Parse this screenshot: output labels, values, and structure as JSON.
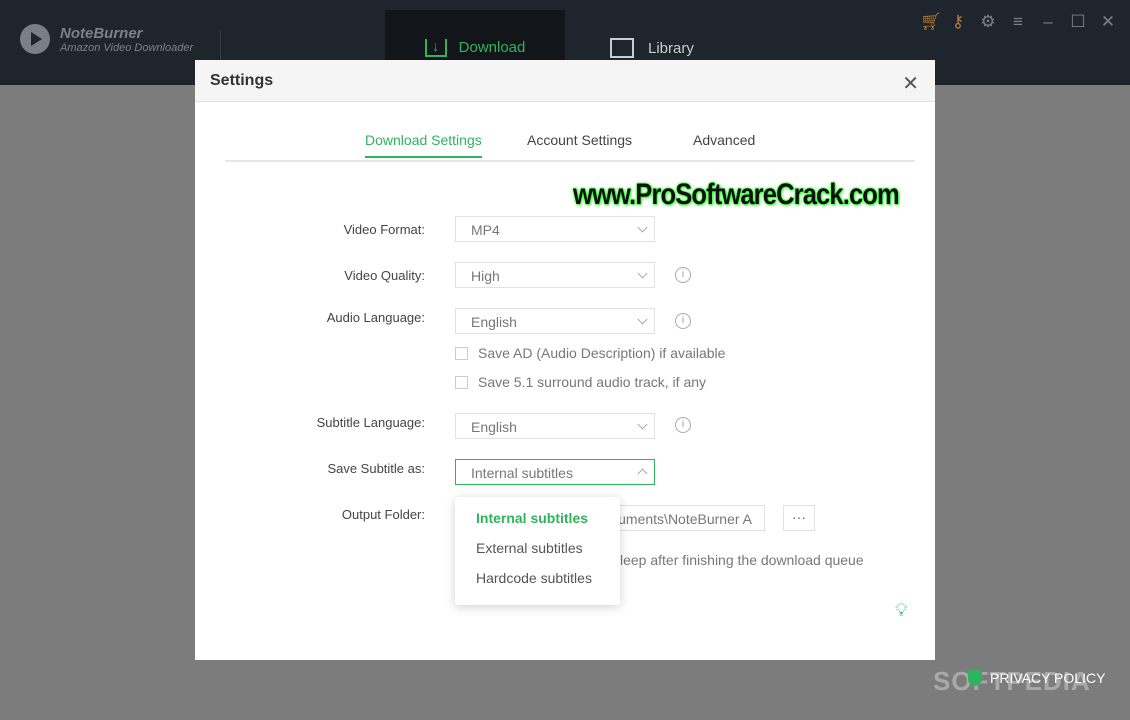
{
  "app": {
    "name": "NoteBurner",
    "subtitle": "Amazon Video Downloader"
  },
  "nav": {
    "download": "Download",
    "library": "Library"
  },
  "title_icons": [
    "cart-icon",
    "key-icon",
    "gear-icon",
    "menu-icon",
    "minimize-icon",
    "maximize-icon",
    "close-icon"
  ],
  "dialog": {
    "title": "Settings",
    "tabs": [
      "Download Settings",
      "Account Settings",
      "Advanced"
    ],
    "fields": {
      "video_format": {
        "label": "Video Format:",
        "value": "MP4"
      },
      "video_quality": {
        "label": "Video Quality:",
        "value": "High"
      },
      "audio_language": {
        "label": "Audio Language:",
        "value": "English"
      },
      "save_ad": "Save AD (Audio Description) if available",
      "save_51": "Save 5.1 surround audio track, if any",
      "subtitle_language": {
        "label": "Subtitle Language:",
        "value": "English"
      },
      "save_subtitle": {
        "label": "Save Subtitle as:",
        "value": "Internal subtitles",
        "options": [
          "Internal subtitles",
          "External subtitles",
          "Hardcode subtitles"
        ]
      },
      "output_folder": {
        "label": "Output Folder:",
        "value": "uments\\NoteBurner A",
        "browse": "···"
      },
      "sleep": "leep after finishing the download queue"
    }
  },
  "watermark": "www.ProSoftwareCrack.com",
  "softpedia": "SOFTPEDIA",
  "privacy": "PRIVACY POLICY",
  "colors": {
    "accent": "#2fb35f",
    "topbar": "#1f252c"
  }
}
